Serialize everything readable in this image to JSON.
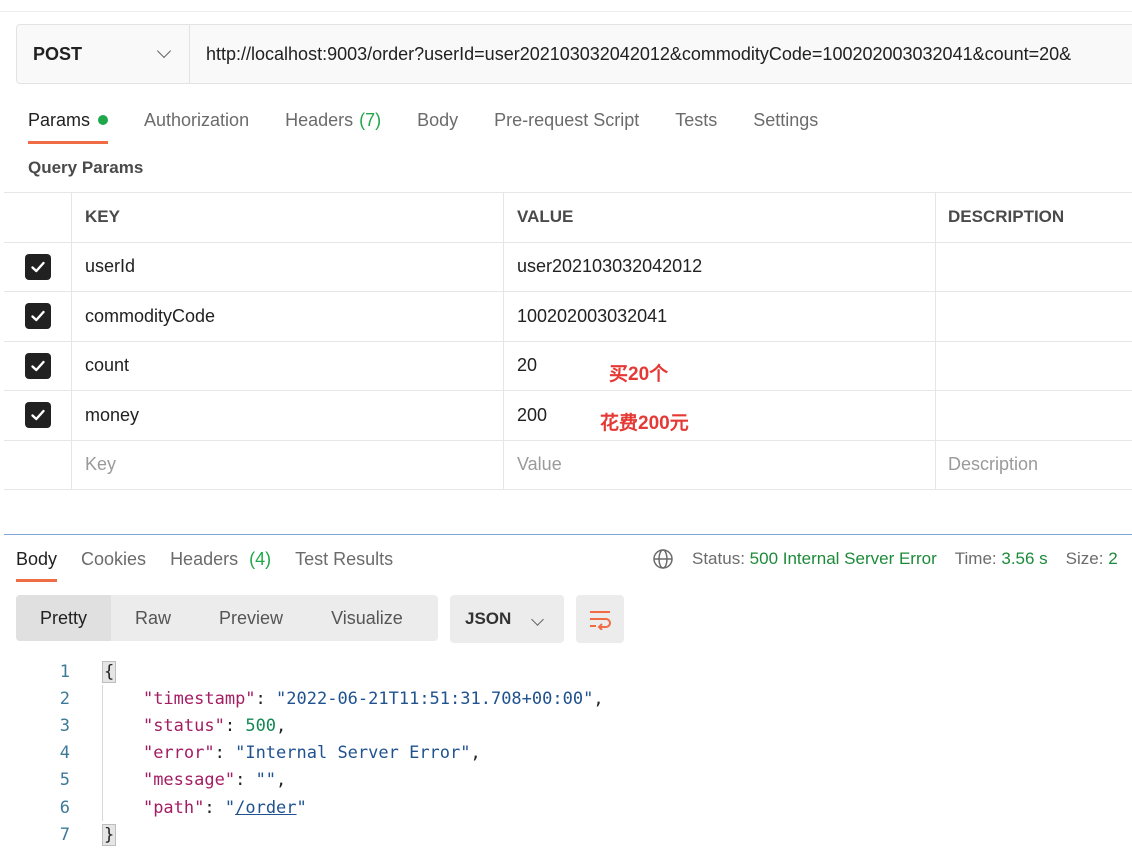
{
  "request": {
    "method": "POST",
    "url": "http://localhost:9003/order?userId=user202103032042012&commodityCode=100202003032041&count=20&"
  },
  "request_tabs": [
    {
      "label": "Params",
      "active": true,
      "indicator": "green-dot"
    },
    {
      "label": "Authorization"
    },
    {
      "label": "Headers",
      "count": "(7)"
    },
    {
      "label": "Body"
    },
    {
      "label": "Pre-request Script"
    },
    {
      "label": "Tests"
    },
    {
      "label": "Settings"
    }
  ],
  "query_params": {
    "title": "Query Params",
    "columns": [
      "KEY",
      "VALUE",
      "DESCRIPTION"
    ],
    "rows": [
      {
        "key": "userId",
        "value": "user202103032042012",
        "checked": true
      },
      {
        "key": "commodityCode",
        "value": "100202003032041",
        "checked": true
      },
      {
        "key": "count",
        "value": "20",
        "checked": true
      },
      {
        "key": "money",
        "value": "200",
        "checked": true
      }
    ],
    "placeholder": {
      "key": "Key",
      "value": "Value",
      "description": "Description"
    }
  },
  "annotations": {
    "count_note": "买20个",
    "money_note": "花费200元"
  },
  "response_tabs": [
    {
      "label": "Body",
      "active": true
    },
    {
      "label": "Cookies"
    },
    {
      "label": "Headers",
      "count": "(4)"
    },
    {
      "label": "Test Results"
    }
  ],
  "response_status": {
    "status_label": "Status:",
    "status_value": "500 Internal Server Error",
    "time_label": "Time:",
    "time_value": "3.56 s",
    "size_label": "Size:",
    "size_value": "2"
  },
  "view_modes": [
    "Pretty",
    "Raw",
    "Preview",
    "Visualize"
  ],
  "format": "JSON",
  "response_body": {
    "line_numbers": [
      "1",
      "2",
      "3",
      "4",
      "5",
      "6",
      "7"
    ],
    "open_brace": "{",
    "close_brace": "}",
    "fields": [
      {
        "key": "\"timestamp\"",
        "value": "\"2022-06-21T11:51:31.708+00:00\""
      },
      {
        "key": "\"status\"",
        "value": "500"
      },
      {
        "key": "\"error\"",
        "value": "\"Internal Server Error\""
      },
      {
        "key": "\"message\"",
        "value": "\"\""
      },
      {
        "key": "\"path\"",
        "value": "/order"
      }
    ]
  },
  "colors": {
    "accent": "#ef6c45",
    "success": "#1ea84a",
    "annotation": "#e53935"
  },
  "icons": [
    "chevron-down-icon",
    "checkbox-checked-icon",
    "globe-icon",
    "wrap-lines-icon"
  ]
}
